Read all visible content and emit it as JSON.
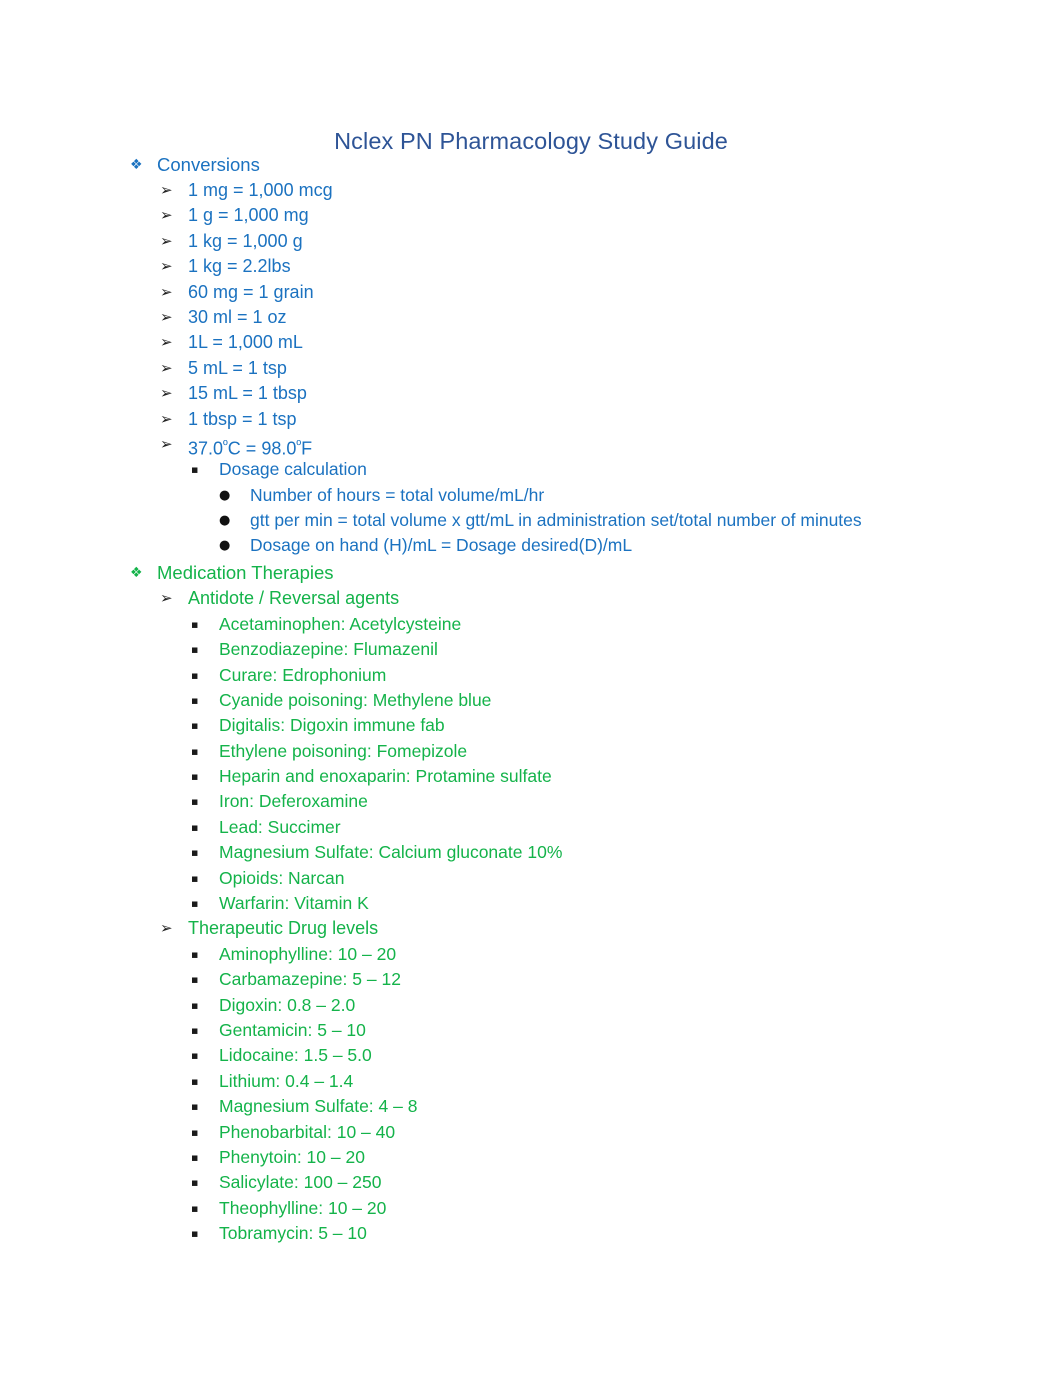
{
  "document": {
    "title": "Nclex PN Pharmacology Study Guide",
    "title_color": "#2E5496",
    "blue": "#1B72C0",
    "green": "#14B34A"
  },
  "bullets": {
    "level1": "❖",
    "level2": "➢",
    "level3": "▪",
    "level4": "●"
  },
  "sections": {
    "conversions": {
      "heading": "Conversions",
      "items": [
        "1 mg = 1,000 mcg",
        "1 g = 1,000 mg",
        "1 kg = 1,000 g",
        "1 kg = 2.2lbs",
        "60 mg = 1 grain",
        "30 ml = 1 oz",
        "1L = 1,000 mL",
        "5 mL = 1 tsp",
        "15 mL = 1 tbsp",
        "1 tbsp = 1 tsp"
      ],
      "temperature": {
        "value_c": "37.0",
        "degree": "º",
        "unit_c": "C",
        "equals": "=",
        "value_f": "98.0",
        "unit_f": "F"
      },
      "dosage_calculation": {
        "heading": "Dosage calculation",
        "formulas": [
          "Number of hours = total volume/mL/hr",
          "gtt per min = total volume x gtt/mL in administration set/total number of minutes",
          "Dosage on hand (H)/mL = Dosage desired(D)/mL"
        ]
      }
    },
    "medication_therapies": {
      "heading": "Medication Therapies",
      "antidotes": {
        "heading": "Antidote / Reversal agents",
        "items": [
          "Acetaminophen: Acetylcysteine",
          "Benzodiazepine: Flumazenil",
          "Curare: Edrophonium",
          "Cyanide poisoning: Methylene blue",
          "Digitalis: Digoxin immune fab",
          "Ethylene poisoning: Fomepizole",
          "Heparin and enoxaparin: Protamine sulfate",
          "Iron: Deferoxamine",
          "Lead: Succimer",
          "Magnesium Sulfate: Calcium gluconate 10%",
          "Opioids: Narcan",
          "Warfarin: Vitamin K"
        ]
      },
      "drug_levels": {
        "heading": "Therapeutic Drug levels",
        "items": [
          "Aminophylline: 10 – 20",
          "Carbamazepine: 5 – 12",
          "Digoxin: 0.8 – 2.0",
          "Gentamicin: 5 – 10",
          "Lidocaine: 1.5 – 5.0",
          "Lithium: 0.4 – 1.4",
          "Magnesium Sulfate: 4 – 8",
          "Phenobarbital: 10 – 40",
          "Phenytoin: 10 – 20",
          "Salicylate: 100 – 250",
          "Theophylline: 10 – 20",
          "Tobramycin: 5 – 10"
        ]
      }
    }
  }
}
